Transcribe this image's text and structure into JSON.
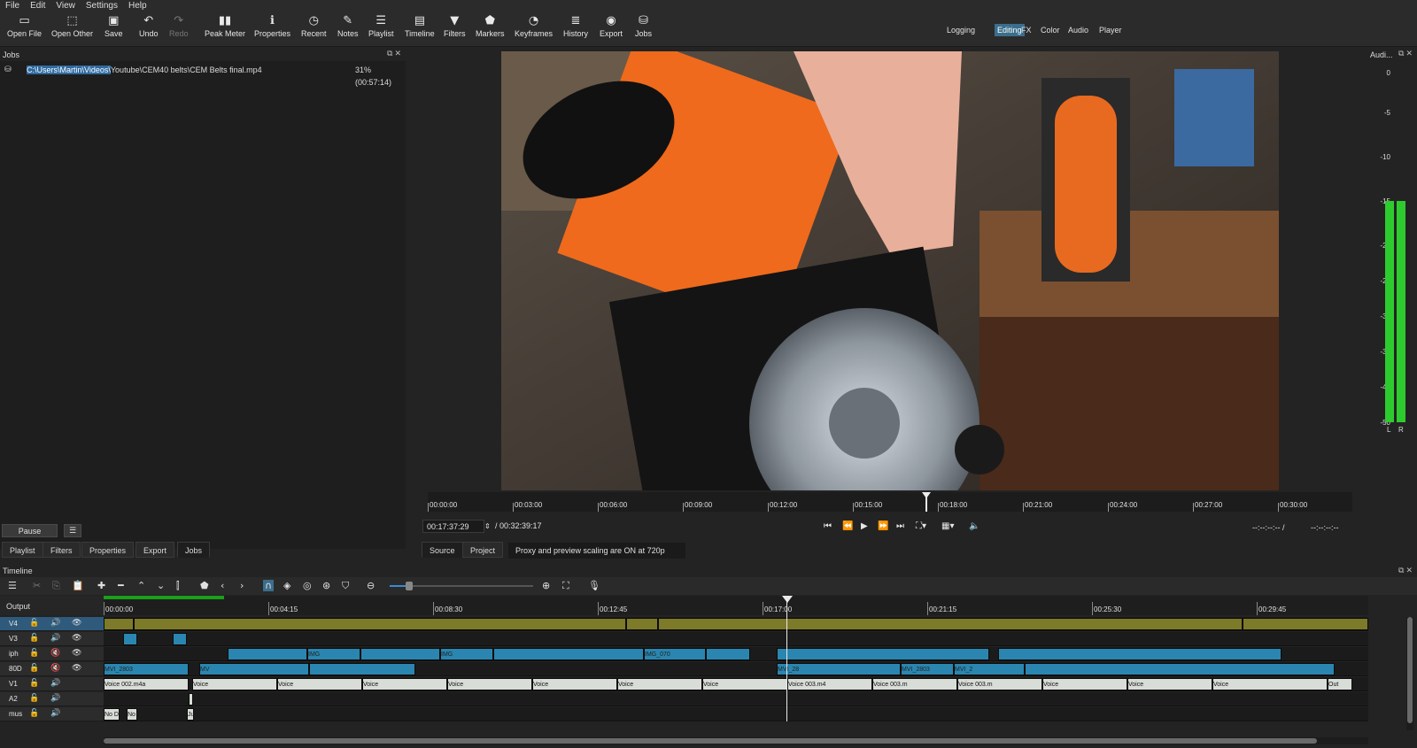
{
  "menu": [
    "File",
    "Edit",
    "View",
    "Settings",
    "Help"
  ],
  "toolbar": {
    "buttons": [
      {
        "label": "Open File",
        "icon": "folder-open-icon",
        "glyph": "▭"
      },
      {
        "label": "Open Other",
        "icon": "open-other-icon",
        "glyph": "⬚"
      },
      {
        "label": "Save",
        "icon": "save-icon",
        "glyph": "💾"
      },
      {
        "label": "Undo",
        "icon": "undo-icon",
        "glyph": "↶"
      },
      {
        "label": "Redo",
        "icon": "redo-icon",
        "glyph": "↷"
      },
      {
        "label": "Peak Meter",
        "icon": "peak-meter-icon",
        "glyph": "▮▮"
      },
      {
        "label": "Properties",
        "icon": "properties-icon",
        "glyph": "ℹ"
      },
      {
        "label": "Recent",
        "icon": "recent-icon",
        "glyph": "◷"
      },
      {
        "label": "Notes",
        "icon": "notes-icon",
        "glyph": "✎"
      },
      {
        "label": "Playlist",
        "icon": "playlist-icon",
        "glyph": "☰"
      },
      {
        "label": "Timeline",
        "icon": "timeline-icon",
        "glyph": "▤"
      },
      {
        "label": "Filters",
        "icon": "filters-icon",
        "glyph": "▼"
      },
      {
        "label": "Markers",
        "icon": "markers-icon",
        "glyph": "⬟"
      },
      {
        "label": "Keyframes",
        "icon": "keyframes-icon",
        "glyph": "⏱"
      },
      {
        "label": "History",
        "icon": "history-icon",
        "glyph": "≣"
      },
      {
        "label": "Export",
        "icon": "export-icon",
        "glyph": "◉"
      },
      {
        "label": "Jobs",
        "icon": "jobs-icon",
        "glyph": "⛁"
      }
    ],
    "layouts": [
      "Logging",
      "Editing",
      "FX",
      "Color",
      "Audio",
      "Player"
    ],
    "active_layout": "Editing"
  },
  "jobs": {
    "title": "Jobs",
    "path_highlight": "C:\\Users\\Martin\\Videos\\",
    "path_rest": "Youtube\\CEM40 belts\\CEM Belts final.mp4",
    "progress": "31% (00:57:14)",
    "pause_label": "Pause",
    "menu_glyph": "☰"
  },
  "left_tabs": [
    "Playlist",
    "Filters",
    "Properties",
    "Export",
    "Jobs"
  ],
  "player": {
    "ruler": [
      "00:00:00",
      "00:03:00",
      "00:06:00",
      "00:09:00",
      "00:12:00",
      "00:15:00",
      "00:18:00",
      "00:21:00",
      "00:24:00",
      "00:27:00",
      "00:30:00"
    ],
    "current_time": "00:17:37:29",
    "total_time": "/ 00:32:39:17",
    "in_point": "--:--:--:-- /",
    "out_point": "--:--:--:--",
    "source_tab": "Source",
    "project_tab": "Project",
    "proxy_message": "Proxy and preview scaling are ON at 720p"
  },
  "audio": {
    "title": "Audi...",
    "scale": [
      "0",
      "-5",
      "-10",
      "-15",
      "-20",
      "-25",
      "-30",
      "-35",
      "-40",
      "-50"
    ],
    "left": "L",
    "right": "R",
    "level_db": -15,
    "peak_db": -10,
    "accent": "#2ecb2e"
  },
  "timeline": {
    "title": "Timeline",
    "output_label": "Output",
    "ruler": [
      "00:00:00",
      "00:04:15",
      "00:08:30",
      "00:12:45",
      "00:17:00",
      "00:21:15",
      "00:25:30",
      "00:29:45"
    ],
    "tracks": [
      {
        "name": "V4",
        "selected": true
      },
      {
        "name": "V3",
        "selected": false
      },
      {
        "name": "iph",
        "selected": false
      },
      {
        "name": "80D",
        "selected": false
      },
      {
        "name": "V1",
        "selected": false
      },
      {
        "name": "A2",
        "selected": false
      },
      {
        "name": "mus",
        "selected": false
      }
    ],
    "clip_labels": {
      "mvi1": "MVI_2803",
      "mvi2": "MV",
      "img1": "IMG",
      "img2": "IMG_070",
      "mvi3": "MVI_28",
      "mvi4": "MVI_2803",
      "mvi5": "MVI_2",
      "voice1": "Voice 002.m4a",
      "voice2": "Voice",
      "voice3": "Voice 003.m",
      "voice4": "Voice 003.m4",
      "voice5": "Voice 003.m",
      "nod": "No D",
      "no": "No",
      "ju": "Ju",
      "out": "Out"
    }
  }
}
